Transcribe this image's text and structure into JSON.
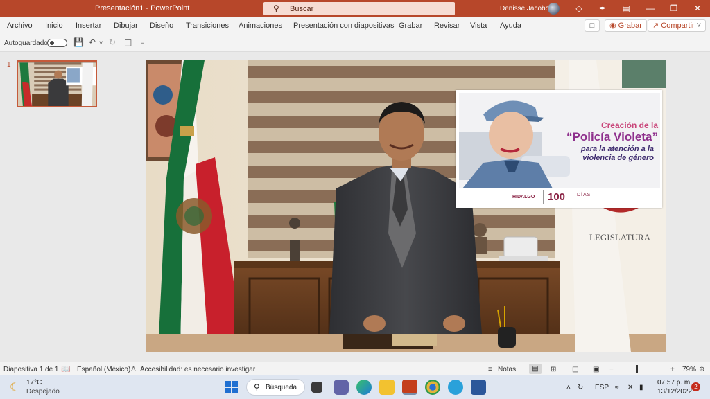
{
  "titlebar": {
    "title": "Presentación1  -  PowerPoint",
    "search_placeholder": "Buscar",
    "user_name": "Denisse Jacobo"
  },
  "ribbon": {
    "tabs": [
      "Archivo",
      "Inicio",
      "Insertar",
      "Dibujar",
      "Diseño",
      "Transiciones",
      "Animaciones",
      "Presentación con diapositivas",
      "Grabar",
      "Revisar",
      "Vista",
      "Ayuda"
    ],
    "record_button": "Grabar",
    "share_button": "Compartir"
  },
  "qat": {
    "autosave_label": "Autoguardado"
  },
  "thumbnails": {
    "slide_number": "1"
  },
  "slide": {
    "banner_title_line1": "Creación de la",
    "banner_title_line2": "“Policía Violeta”",
    "banner_sub_line1": "para la atención a la",
    "banner_sub_line2": "violencia de género",
    "banner_logo_left": "HIDALGO",
    "banner_logo_num": "100",
    "banner_logo_right": "DÍAS",
    "wall_text": "LEGISLATURA",
    "colors": {
      "accent_purple": "#8e2f8c",
      "ppt_red": "#b7472a"
    }
  },
  "statusbar": {
    "slide_info": "Diapositiva 1 de 1",
    "language": "Español (México)",
    "accessibility": "Accesibilidad: es necesario investigar",
    "notes": "Notas",
    "zoom": "79%"
  },
  "taskbar": {
    "temperature": "17°C",
    "condition": "Despejado",
    "search_label": "Búsqueda",
    "language": "ESP",
    "time": "07:57 p. m.",
    "date": "13/12/2022",
    "notification_count": "2"
  }
}
